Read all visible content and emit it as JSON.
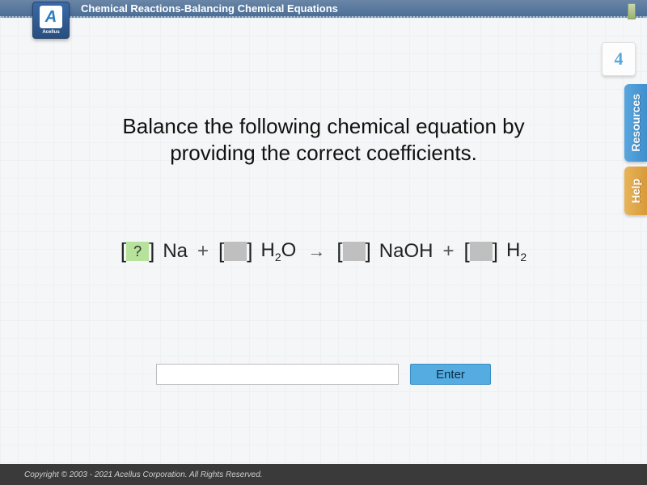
{
  "header": {
    "title": "Chemical Reactions-Balancing Chemical Equations"
  },
  "logo": {
    "letter": "A",
    "brand": "Acellus"
  },
  "step": {
    "number": "4"
  },
  "side_tabs": {
    "resources": "Resources",
    "help": "Help"
  },
  "prompt": "Balance the following chemical equation by providing the correct coefficients.",
  "equation": {
    "slots": [
      {
        "placeholder": "?",
        "active": true,
        "term": "Na"
      },
      {
        "placeholder": "",
        "active": false,
        "term": "H2O"
      },
      {
        "placeholder": "",
        "active": false,
        "term": "NaOH"
      },
      {
        "placeholder": "",
        "active": false,
        "term": "H2"
      }
    ],
    "plus": "+",
    "arrow": "→"
  },
  "answer": {
    "value": "",
    "button": "Enter"
  },
  "footer": {
    "copyright": "Copyright © 2003 - 2021 Acellus Corporation.  All Rights Reserved."
  }
}
